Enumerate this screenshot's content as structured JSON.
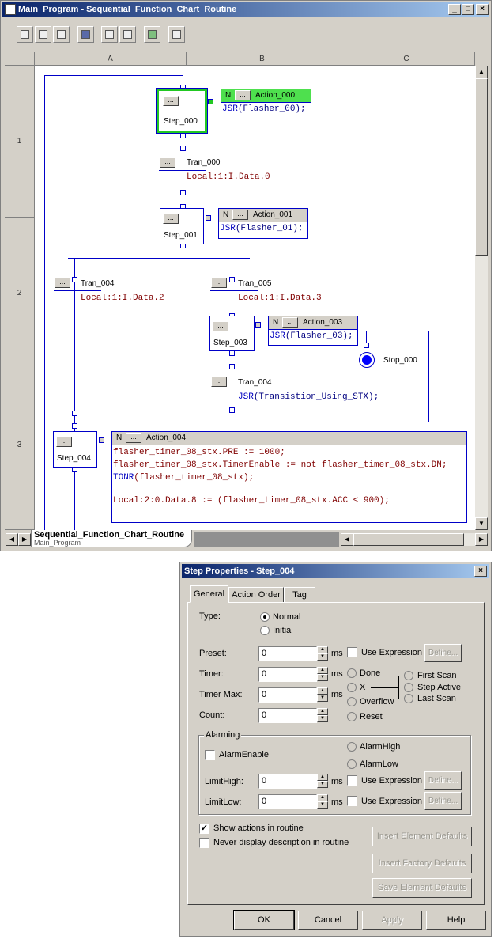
{
  "editor": {
    "title": "Main_Program - Sequential_Function_Chart_Routine",
    "columns": [
      "A",
      "B",
      "C"
    ],
    "rows": [
      "1",
      "2",
      "3"
    ],
    "dots": "...",
    "steps": {
      "s0": "Step_000",
      "s1": "Step_001",
      "s3": "Step_003",
      "s4": "Step_004"
    },
    "transitions": {
      "t0": "Tran_000",
      "t4": "Tran_004",
      "t5": "Tran_005",
      "t4b": "Tran_004"
    },
    "conditions": {
      "c0": "Local:1:I.Data.0",
      "c4": "Local:1:I.Data.2",
      "c5": "Local:1:I.Data.3"
    },
    "stop": "Stop_000",
    "actions": {
      "a0": {
        "q": "N",
        "name": "Action_000",
        "fn": "JSR",
        "arg": "(Flasher_00);"
      },
      "a1": {
        "q": "N",
        "name": "Action_001",
        "fn": "JSR",
        "arg": "(Flasher_01);"
      },
      "a3": {
        "q": "N",
        "name": "Action_003",
        "fn": "JSR",
        "arg": "(Flasher_03);"
      },
      "a4": {
        "q": "N",
        "name": "Action_004",
        "line1": "flasher_timer_08_stx.PRE := 1000;",
        "line2": "flasher_timer_08_stx.TimerEnable := not flasher_timer_08_stx.DN;",
        "line3fn": "TONR",
        "line3arg": "(flasher_timer_08_stx);",
        "line4": "Local:2:0.Data.8 := (flasher_timer_08_stx.ACC < 900);"
      }
    },
    "t4b_fn": "JSR",
    "t4b_arg": "(Transistion_Using_STX);",
    "tab": {
      "label": "Sequential_Function_Chart_Routine",
      "sub": "Main_Program"
    }
  },
  "dialog": {
    "title": "Step Properties - Step_004",
    "close": "×",
    "tabs": [
      "General",
      "Action Order",
      "Tag"
    ],
    "type_label": "Type:",
    "type_normal": "Normal",
    "type_initial": "Initial",
    "preset_label": "Preset:",
    "timer_label": "Timer:",
    "timermax_label": "Timer Max:",
    "count_label": "Count:",
    "value": "0",
    "ms": "ms",
    "use_expression": "Use Expression",
    "define": "Define...",
    "done": "Done",
    "x": "X",
    "overflow": "Overflow",
    "reset": "Reset",
    "first_scan": "First Scan",
    "step_active": "Step Active",
    "last_scan": "Last Scan",
    "alarming": "Alarming",
    "alarm_enable": "AlarmEnable",
    "alarm_high": "AlarmHigh",
    "alarm_low": "AlarmLow",
    "limit_high": "LimitHigh:",
    "limit_low": "LimitLow:",
    "show_actions": "Show actions in routine",
    "never_display": "Never display description in routine",
    "insert_elem": "Insert Element Defaults",
    "insert_factory": "Insert Factory Defaults",
    "save_elem": "Save Element Defaults",
    "ok": "OK",
    "cancel": "Cancel",
    "apply": "Apply",
    "help": "Help"
  }
}
